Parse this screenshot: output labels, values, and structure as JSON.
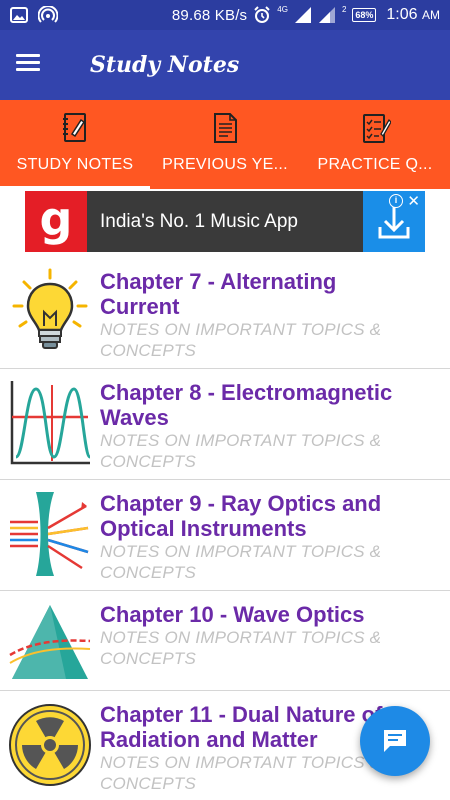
{
  "status_bar": {
    "speed": "89.68 KB/s",
    "network": "4G",
    "sim_index": "2",
    "battery": "68%",
    "time": "1:06",
    "ampm": "AM",
    "left_icons": [
      "image-icon",
      "hotspot-icon"
    ],
    "right_icons": [
      "alarm-icon",
      "signal-icon",
      "signal-icon",
      "battery-icon"
    ]
  },
  "app_bar": {
    "title": "Study Notes",
    "menu_icon": "hamburger-menu-icon"
  },
  "tabs": [
    {
      "label": "STUDY NOTES",
      "icon": "notebook-icon",
      "active": true
    },
    {
      "label": "PREVIOUS YE...",
      "icon": "document-icon",
      "active": false
    },
    {
      "label": "PRACTICE Q...",
      "icon": "checklist-icon",
      "active": false
    }
  ],
  "ad": {
    "logo_letter": "g",
    "text": "India's No. 1 Music App",
    "info_glyph": "i",
    "close_glyph": "✕"
  },
  "chapters": [
    {
      "title_line1": "Chapter 7 - Alternating",
      "title_line2": "Current",
      "sub_line1": "NOTES ON IMPORTANT TOPICS &",
      "sub_line2": "CONCEPTS",
      "icon": "light-bulb-icon"
    },
    {
      "title_line1": "Chapter 8 - Electromagnetic",
      "title_line2": "Waves",
      "sub_line1": "NOTES ON IMPORTANT TOPICS &",
      "sub_line2": "CONCEPTS",
      "icon": "wave-graph-icon"
    },
    {
      "title_line1": "Chapter 9 - Ray Optics and",
      "title_line2": "Optical Instruments",
      "sub_line1": "NOTES ON IMPORTANT TOPICS &",
      "sub_line2": "CONCEPTS",
      "icon": "lens-rays-icon"
    },
    {
      "title_line1": "Chapter 10 - Wave Optics",
      "sub_line1": "NOTES ON IMPORTANT TOPICS &",
      "sub_line2": "CONCEPTS",
      "icon": "prism-icon"
    },
    {
      "title_line1": "Chapter 11 - Dual Nature of",
      "title_line2": "Radiation and Matter",
      "sub_line1": "NOTES ON IMPORTANT TOPICS &",
      "sub_line2": "CONCEPTS",
      "icon": "radiation-icon"
    }
  ],
  "fab": {
    "icon": "chat-icon"
  },
  "colors": {
    "status_bar": "#2c3da0",
    "app_bar": "#3344ad",
    "tab_bar": "#ff5722",
    "chapter_title": "#6b2aa8",
    "subtitle": "#c2c2c2",
    "fab": "#1e8ae6",
    "ad_logo": "#e41e26",
    "ad_download": "#1a8ee8"
  }
}
